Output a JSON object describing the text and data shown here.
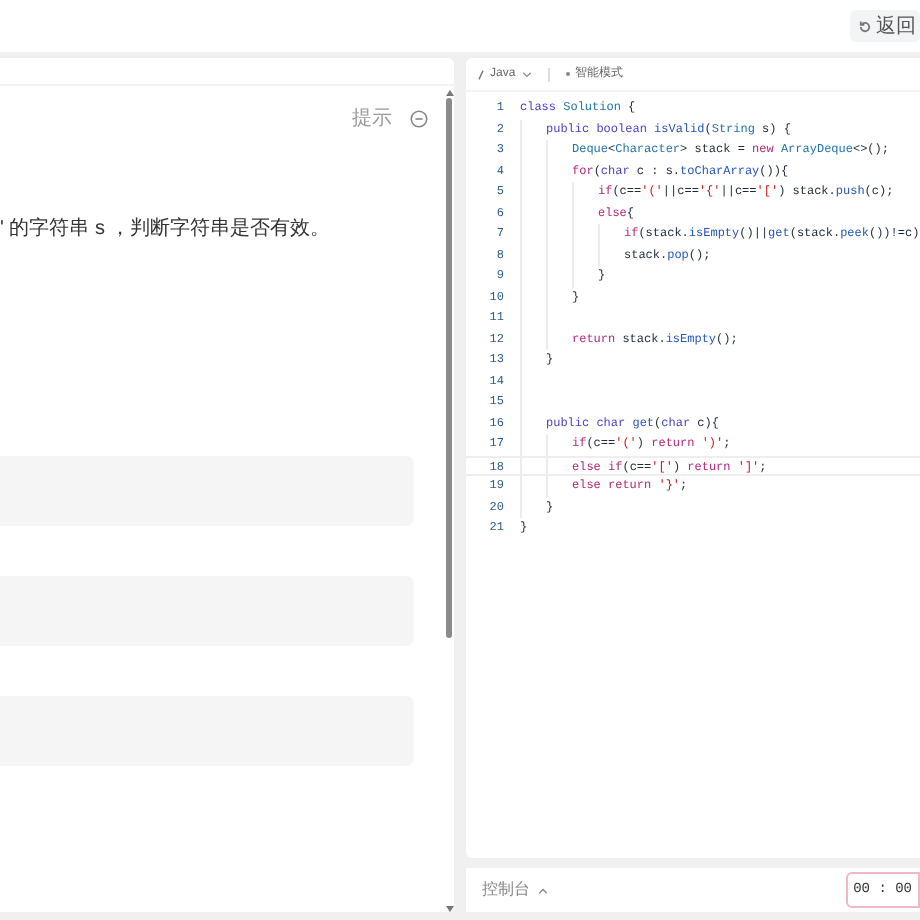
{
  "top_bar": {
    "back_button": "返回"
  },
  "problem": {
    "hint": "提示",
    "description": "' 的字符串 s ，判断字符串是否有效。"
  },
  "editor": {
    "language": "Java",
    "mode": "智能模式",
    "lines": [
      {
        "number": "1",
        "segments": [
          {
            "kind": "kw",
            "text": "class"
          },
          {
            "kind": "type",
            "text": " Solution"
          },
          {
            "kind": "plain",
            "text": " {"
          }
        ],
        "children": [
          {
            "number": "2",
            "segments": [
              {
                "kind": "kw",
                "text": "public"
              },
              {
                "kind": "kw",
                "text": " boolean"
              },
              {
                "kind": "fn",
                "text": " isValid"
              },
              {
                "kind": "plain",
                "text": "("
              },
              {
                "kind": "type",
                "text": "String"
              },
              {
                "kind": "plain",
                "text": " s) {"
              }
            ],
            "children": [
              {
                "number": "3",
                "segments": [
                  {
                    "kind": "type",
                    "text": "Deque"
                  },
                  {
                    "kind": "plain",
                    "text": "<"
                  },
                  {
                    "kind": "type",
                    "text": "Character"
                  },
                  {
                    "kind": "plain",
                    "text": "> stack = "
                  },
                  {
                    "kind": "ctrl",
                    "text": "new"
                  },
                  {
                    "kind": "type",
                    "text": " ArrayDeque"
                  },
                  {
                    "kind": "plain",
                    "text": "<>();"
                  }
                ]
              },
              {
                "number": "4",
                "segments": [
                  {
                    "kind": "ctrl",
                    "text": "for"
                  },
                  {
                    "kind": "plain",
                    "text": "("
                  },
                  {
                    "kind": "kw",
                    "text": "char"
                  },
                  {
                    "kind": "plain",
                    "text": " c : s."
                  },
                  {
                    "kind": "fn",
                    "text": "toCharArray"
                  },
                  {
                    "kind": "plain",
                    "text": "()){"
                  }
                ],
                "children": [
                  {
                    "number": "5",
                    "segments": [
                      {
                        "kind": "ctrl",
                        "text": "if"
                      },
                      {
                        "kind": "plain",
                        "text": "(c=="
                      },
                      {
                        "kind": "str",
                        "text": "'('"
                      },
                      {
                        "kind": "plain",
                        "text": "||c=="
                      },
                      {
                        "kind": "str",
                        "text": "'{'"
                      },
                      {
                        "kind": "plain",
                        "text": "||c=="
                      },
                      {
                        "kind": "str",
                        "text": "'['"
                      },
                      {
                        "kind": "plain",
                        "text": ") stack."
                      },
                      {
                        "kind": "fn",
                        "text": "push"
                      },
                      {
                        "kind": "plain",
                        "text": "(c);"
                      }
                    ]
                  },
                  {
                    "number": "6",
                    "segments": [
                      {
                        "kind": "ctrl",
                        "text": "else"
                      },
                      {
                        "kind": "plain",
                        "text": "{"
                      }
                    ],
                    "children": [
                      {
                        "number": "7",
                        "segments": [
                          {
                            "kind": "ctrl",
                            "text": "if"
                          },
                          {
                            "kind": "plain",
                            "text": "(stack."
                          },
                          {
                            "kind": "fn",
                            "text": "isEmpty"
                          },
                          {
                            "kind": "plain",
                            "text": "()||"
                          },
                          {
                            "kind": "fn",
                            "text": "get"
                          },
                          {
                            "kind": "plain",
                            "text": "(stack."
                          },
                          {
                            "kind": "fn",
                            "text": "peek"
                          },
                          {
                            "kind": "plain",
                            "text": "())!=c)"
                          }
                        ]
                      },
                      {
                        "number": "8",
                        "segments": [
                          {
                            "kind": "plain",
                            "text": "stack."
                          },
                          {
                            "kind": "fn",
                            "text": "pop"
                          },
                          {
                            "kind": "plain",
                            "text": "();"
                          }
                        ]
                      }
                    ]
                  },
                  {
                    "number": "9",
                    "segments": [
                      {
                        "kind": "plain",
                        "text": "}"
                      }
                    ]
                  }
                ]
              },
              {
                "number": "10",
                "segments": [
                  {
                    "kind": "plain",
                    "text": "}"
                  }
                ]
              },
              {
                "number": "11"
              },
              {
                "number": "12",
                "segments": [
                  {
                    "kind": "ctrl",
                    "text": "return"
                  },
                  {
                    "kind": "plain",
                    "text": " stack."
                  },
                  {
                    "kind": "fn",
                    "text": "isEmpty"
                  },
                  {
                    "kind": "plain",
                    "text": "();"
                  }
                ]
              }
            ]
          },
          {
            "number": "13",
            "segments": [
              {
                "kind": "plain",
                "text": "}"
              }
            ]
          },
          {
            "number": "14"
          },
          {
            "number": "15"
          },
          {
            "number": "16",
            "segments": [
              {
                "kind": "kw",
                "text": "public"
              },
              {
                "kind": "kw",
                "text": " char"
              },
              {
                "kind": "fn",
                "text": " get"
              },
              {
                "kind": "plain",
                "text": "("
              },
              {
                "kind": "kw",
                "text": "char"
              },
              {
                "kind": "plain",
                "text": " c){"
              }
            ],
            "children": [
              {
                "number": "17",
                "segments": [
                  {
                    "kind": "ctrl",
                    "text": "if"
                  },
                  {
                    "kind": "plain",
                    "text": "(c=="
                  },
                  {
                    "kind": "str",
                    "text": "'('"
                  },
                  {
                    "kind": "plain",
                    "text": ") "
                  },
                  {
                    "kind": "ctrl",
                    "text": "return"
                  },
                  {
                    "kind": "str",
                    "text": " ')'"
                  },
                  {
                    "kind": "plain",
                    "text": ";"
                  }
                ]
              },
              {
                "number": "18",
                "current": true,
                "segments": [
                  {
                    "kind": "ctrl",
                    "text": "else"
                  },
                  {
                    "kind": "ctrl",
                    "text": " if"
                  },
                  {
                    "kind": "plain",
                    "text": "(c=="
                  },
                  {
                    "kind": "str",
                    "text": "'['"
                  },
                  {
                    "kind": "plain",
                    "text": ") "
                  },
                  {
                    "kind": "ctrl",
                    "text": "return"
                  },
                  {
                    "kind": "str",
                    "text": " ']'"
                  },
                  {
                    "kind": "plain",
                    "text": ";"
                  }
                ]
              },
              {
                "number": "19",
                "segments": [
                  {
                    "kind": "ctrl",
                    "text": "else"
                  },
                  {
                    "kind": "ctrl",
                    "text": " return"
                  },
                  {
                    "kind": "str",
                    "text": " '}'"
                  },
                  {
                    "kind": "plain",
                    "text": ";"
                  }
                ]
              }
            ]
          },
          {
            "number": "20",
            "segments": [
              {
                "kind": "plain",
                "text": "}"
              }
            ]
          }
        ]
      },
      {
        "number": "21",
        "segments": [
          {
            "kind": "plain",
            "text": "}"
          }
        ]
      }
    ]
  },
  "console_bar": {
    "label": "控制台",
    "timer": "00 : 00"
  }
}
